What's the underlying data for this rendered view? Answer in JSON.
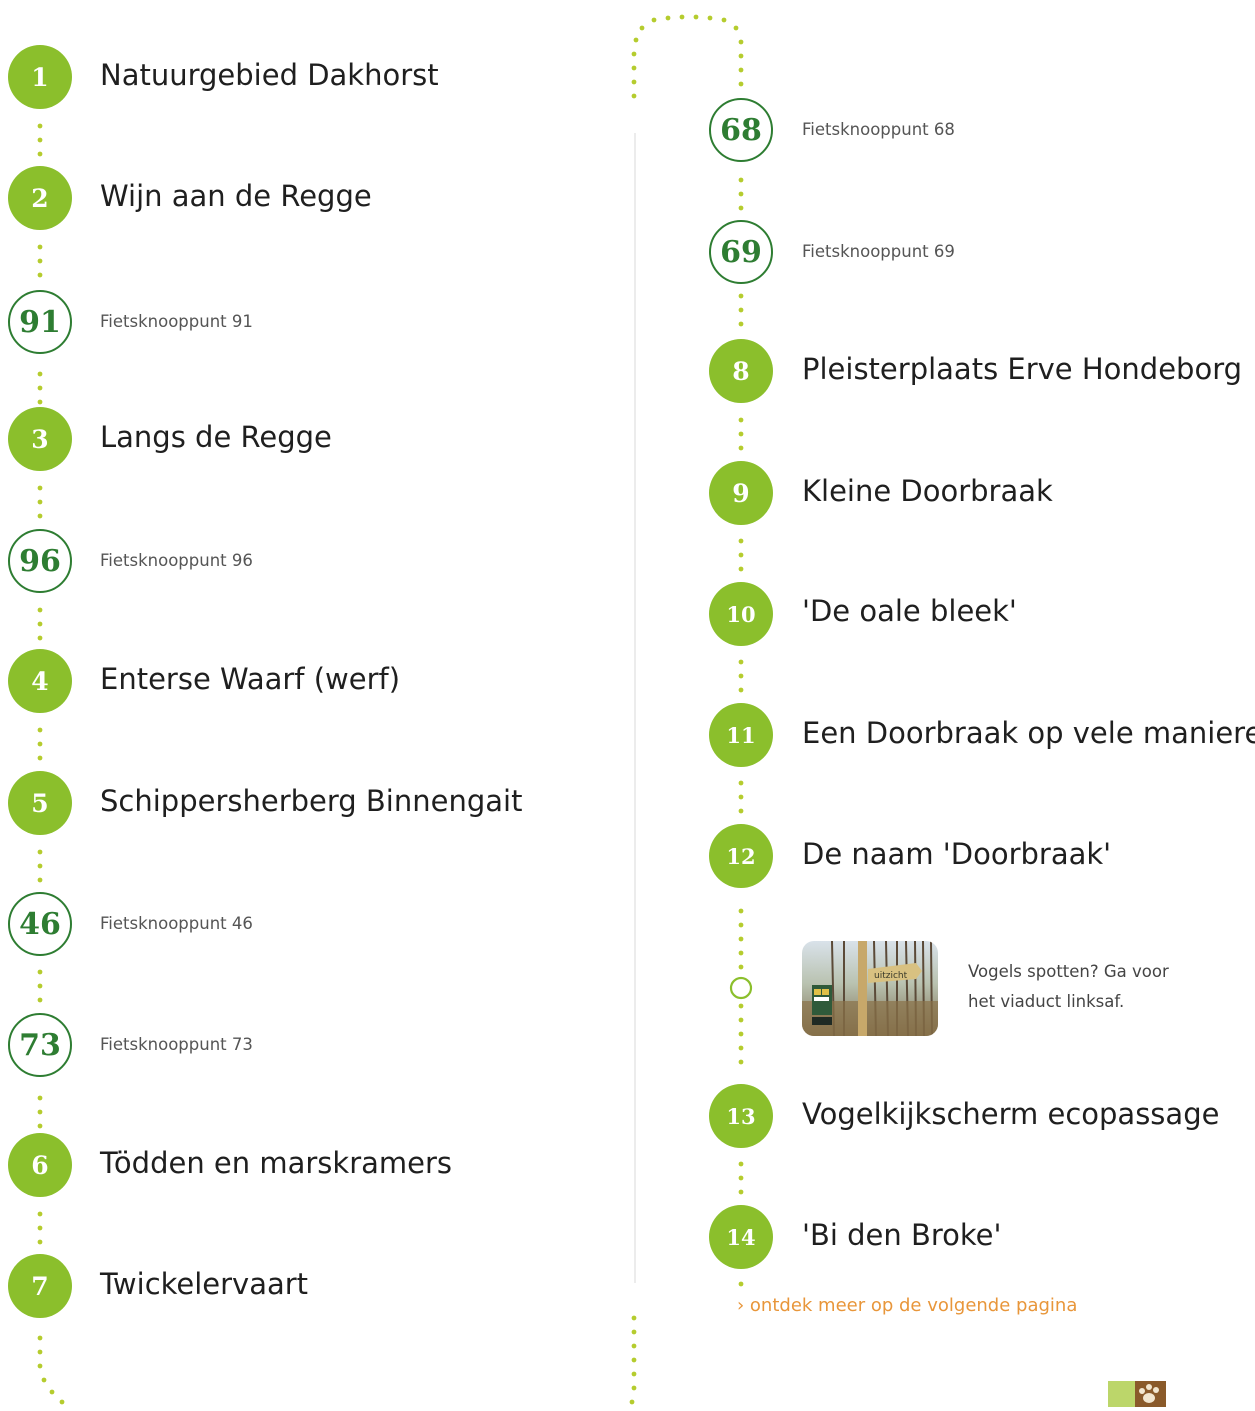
{
  "stops": [
    {
      "num": "1",
      "name": "Natuurgebied Dakhorst"
    },
    {
      "num": "2",
      "name": "Wijn aan de Regge"
    },
    {
      "num": "91",
      "name": "Fietsknooppunt 91"
    },
    {
      "num": "3",
      "name": "Langs de Regge"
    },
    {
      "num": "96",
      "name": "Fietsknooppunt 96"
    },
    {
      "num": "4",
      "name": "Enterse Waarf (werf)"
    },
    {
      "num": "5",
      "name": "Schippersherberg Binnengait"
    },
    {
      "num": "46",
      "name": "Fietsknooppunt 46"
    },
    {
      "num": "73",
      "name": "Fietsknooppunt 73"
    },
    {
      "num": "6",
      "name": "Tödden en marskramers"
    },
    {
      "num": "7",
      "name": "Twickelervaart"
    },
    {
      "num": "68",
      "name": "Fietsknooppunt 68"
    },
    {
      "num": "69",
      "name": "Fietsknooppunt 69"
    },
    {
      "num": "8",
      "name": "Pleisterplaats Erve Hondeborg"
    },
    {
      "num": "9",
      "name": "Kleine Doorbraak"
    },
    {
      "num": "10",
      "name": "'De oale bleek'"
    },
    {
      "num": "11",
      "name": "Een Doorbraak op vele manieren"
    },
    {
      "num": "12",
      "name": "De naam 'Doorbraak'"
    },
    {
      "num": "13",
      "name": "Vogelkijkscherm ecopassage"
    },
    {
      "num": "14",
      "name": "'Bi den Broke'"
    }
  ],
  "info": {
    "text_line1": "Vogels spotten? Ga voor",
    "text_line2": "het viaduct linksaf.",
    "sign_text": "uitzicht"
  },
  "more_link": "› ontdek meer op de volgende pagina",
  "colors": {
    "poi_green": "#8bbf2c",
    "knooppunt_green": "#2e7d32",
    "link_orange": "#e8963a",
    "dots": "#b5cc2e"
  }
}
